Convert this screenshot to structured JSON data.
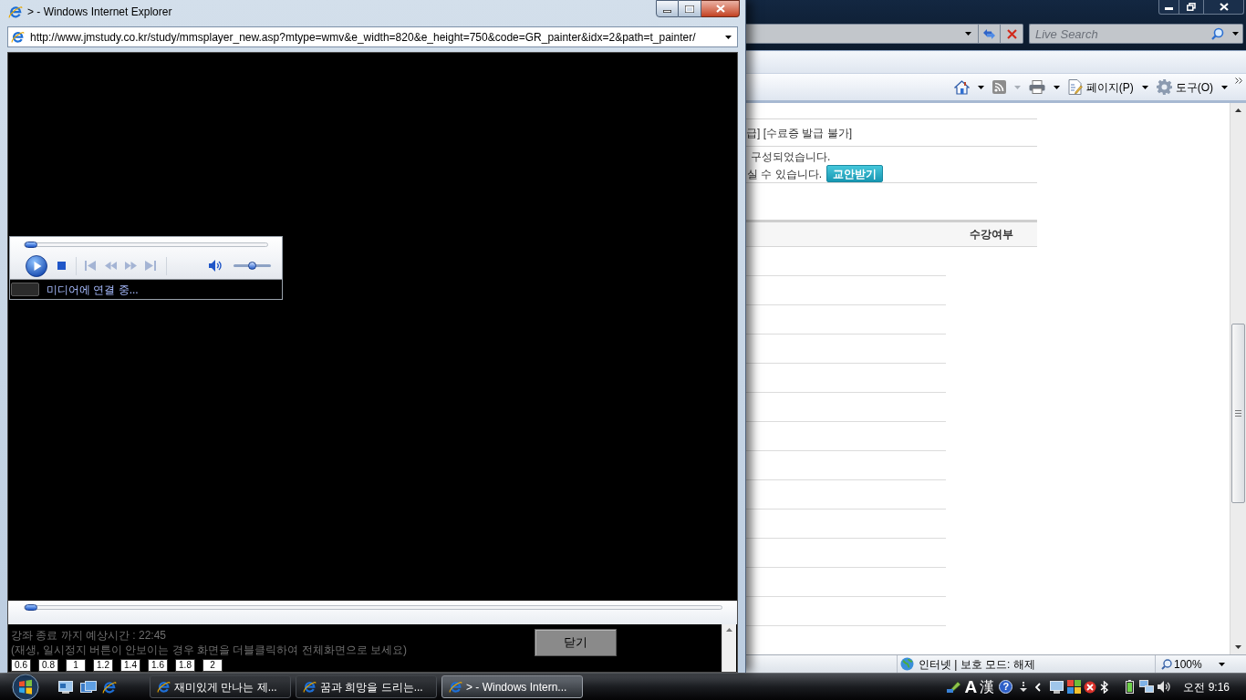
{
  "popup": {
    "title": "> - Windows Internet Explorer",
    "address": "http://www.jmstudy.co.kr/study/mmsplayer_new.asp?mtype=wmv&e_width=820&e_height=750&code=GR_painter&idx=2&path=t_painter/",
    "player": {
      "seek": {
        "level": 0
      },
      "controls": [
        {
          "kind": "play",
          "disabled": false
        },
        {
          "kind": "stop",
          "disabled": false
        },
        {
          "kind": "previous",
          "disabled": true
        },
        {
          "kind": "rewind",
          "disabled": true
        },
        {
          "kind": "fast_forward",
          "disabled": true
        },
        {
          "kind": "next",
          "disabled": true
        }
      ],
      "volume": {
        "level": 0.5
      },
      "status": "미디어에 연결 중..."
    },
    "lower_seek": {
      "level": 0
    },
    "notes": [
      "강좌 종료 까지 예상시간 : 22:45",
      "(재생, 일시정지 버튼이 안보이는 경우 화면을 더블클릭하여 전체화면으로 보세요)"
    ],
    "close_button": "닫기",
    "speeds": [
      "0.6",
      "0.8",
      "1",
      "1.2",
      "1.4",
      "1.6",
      "1.8",
      "2"
    ]
  },
  "browser": {
    "search": {
      "placeholder": "Live Search"
    },
    "command_bar": [
      {
        "kind": "home",
        "disabled": false
      },
      {
        "kind": "feeds",
        "disabled": true
      },
      {
        "kind": "print",
        "disabled": false
      },
      {
        "kind": "page",
        "label": "페이지(P)",
        "disabled": false
      },
      {
        "kind": "tools",
        "label": "도구(O)",
        "disabled": false
      }
    ],
    "page": {
      "certificate_note": "급] [수료증 발급 불가]",
      "notice_lines": [
        "구성되었습니다.",
        "실 수 있습니다."
      ],
      "handout_button": "교안받기",
      "table": {
        "columns": [
          "수강여부"
        ]
      }
    },
    "status_bar": {
      "zone": "인터넷 | 보호 모드: 해제",
      "zoom": "100%"
    }
  },
  "taskbar": {
    "tasks": [
      {
        "label": "재미있게 만나는 제...",
        "selected": false
      },
      {
        "label": "꿈과 희망을 드리는...",
        "selected": false
      },
      {
        "label": "> - Windows Intern...",
        "selected": true
      }
    ],
    "tray": {
      "ime": [
        "A",
        "漢"
      ],
      "help": "?"
    },
    "clock": "오전 9:16"
  }
}
